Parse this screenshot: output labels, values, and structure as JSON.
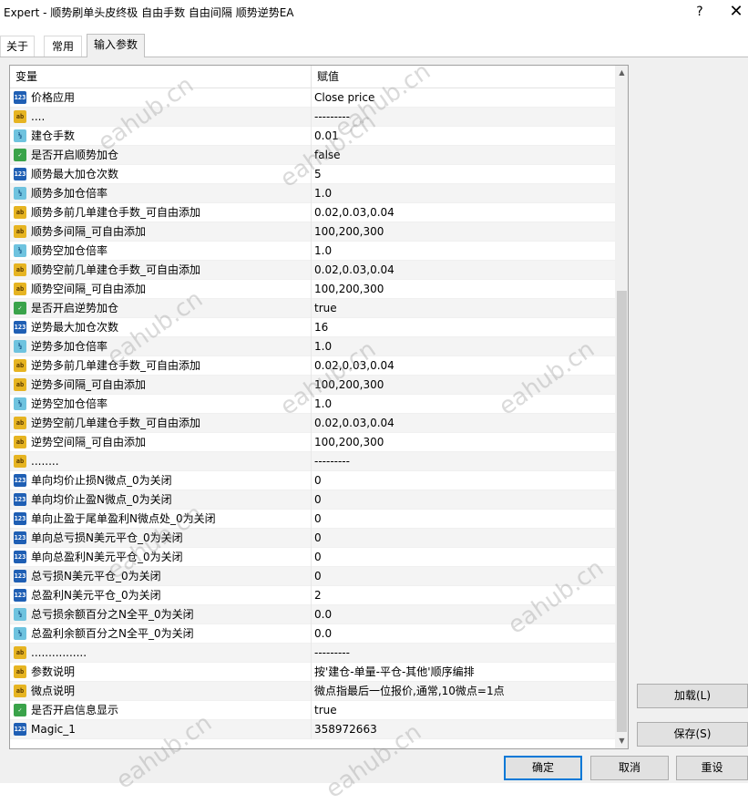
{
  "window": {
    "title": "Expert - 顺势刷单头皮终极 自由手数 自由间隔 顺势逆势EA",
    "help_label": "?",
    "close_label": "✕"
  },
  "tabs": [
    {
      "label": "关于"
    },
    {
      "label": "常用"
    },
    {
      "label": "输入参数"
    }
  ],
  "grid": {
    "col_variable": "变量",
    "col_value": "赋值",
    "rows": [
      {
        "type": "int",
        "icon": "123",
        "name": "价格应用",
        "value": "Close price"
      },
      {
        "type": "str",
        "icon": "ab",
        "name": "....",
        "value": "---------"
      },
      {
        "type": "dbl",
        "icon": "½",
        "name": "建仓手数",
        "value": "0.01"
      },
      {
        "type": "bool",
        "icon": "✓",
        "name": "是否开启顺势加仓",
        "value": "false"
      },
      {
        "type": "int",
        "icon": "123",
        "name": "顺势最大加仓次数",
        "value": "5"
      },
      {
        "type": "dbl",
        "icon": "½",
        "name": "顺势多加仓倍率",
        "value": "1.0"
      },
      {
        "type": "str",
        "icon": "ab",
        "name": "顺势多前几单建仓手数_可自由添加",
        "value": "0.02,0.03,0.04"
      },
      {
        "type": "str",
        "icon": "ab",
        "name": "顺势多间隔_可自由添加",
        "value": "100,200,300"
      },
      {
        "type": "dbl",
        "icon": "½",
        "name": "顺势空加仓倍率",
        "value": "1.0"
      },
      {
        "type": "str",
        "icon": "ab",
        "name": "顺势空前几单建仓手数_可自由添加",
        "value": "0.02,0.03,0.04"
      },
      {
        "type": "str",
        "icon": "ab",
        "name": "顺势空间隔_可自由添加",
        "value": "100,200,300"
      },
      {
        "type": "bool",
        "icon": "✓",
        "name": "是否开启逆势加仓",
        "value": "true"
      },
      {
        "type": "int",
        "icon": "123",
        "name": "逆势最大加仓次数",
        "value": "16"
      },
      {
        "type": "dbl",
        "icon": "½",
        "name": "逆势多加仓倍率",
        "value": "1.0"
      },
      {
        "type": "str",
        "icon": "ab",
        "name": "逆势多前几单建仓手数_可自由添加",
        "value": "0.02,0.03,0.04"
      },
      {
        "type": "str",
        "icon": "ab",
        "name": "逆势多间隔_可自由添加",
        "value": "100,200,300"
      },
      {
        "type": "dbl",
        "icon": "½",
        "name": "逆势空加仓倍率",
        "value": "1.0"
      },
      {
        "type": "str",
        "icon": "ab",
        "name": "逆势空前几单建仓手数_可自由添加",
        "value": "0.02,0.03,0.04"
      },
      {
        "type": "str",
        "icon": "ab",
        "name": "逆势空间隔_可自由添加",
        "value": "100,200,300"
      },
      {
        "type": "str",
        "icon": "ab",
        "name": "........",
        "value": "---------"
      },
      {
        "type": "int",
        "icon": "123",
        "name": "单向均价止损N微点_0为关闭",
        "value": "0"
      },
      {
        "type": "int",
        "icon": "123",
        "name": "单向均价止盈N微点_0为关闭",
        "value": "0"
      },
      {
        "type": "int",
        "icon": "123",
        "name": "单向止盈于尾单盈利N微点处_0为关闭",
        "value": "0"
      },
      {
        "type": "int",
        "icon": "123",
        "name": "单向总亏损N美元平仓_0为关闭",
        "value": "0"
      },
      {
        "type": "int",
        "icon": "123",
        "name": "单向总盈利N美元平仓_0为关闭",
        "value": "0"
      },
      {
        "type": "int",
        "icon": "123",
        "name": "总亏损N美元平仓_0为关闭",
        "value": "0"
      },
      {
        "type": "int",
        "icon": "123",
        "name": "总盈利N美元平仓_0为关闭",
        "value": "2"
      },
      {
        "type": "dbl",
        "icon": "½",
        "name": "总亏损余额百分之N全平_0为关闭",
        "value": "0.0"
      },
      {
        "type": "dbl",
        "icon": "½",
        "name": "总盈利余额百分之N全平_0为关闭",
        "value": "0.0"
      },
      {
        "type": "str",
        "icon": "ab",
        "name": "................",
        "value": "---------"
      },
      {
        "type": "str",
        "icon": "ab",
        "name": "参数说明",
        "value": "按'建仓-单量-平仓-其他'顺序编排"
      },
      {
        "type": "str",
        "icon": "ab",
        "name": "微点说明",
        "value": "微点指最后一位报价,通常,10微点=1点"
      },
      {
        "type": "bool",
        "icon": "✓",
        "name": "是否开启信息显示",
        "value": "true"
      },
      {
        "type": "int",
        "icon": "123",
        "name": "Magic_1",
        "value": "358972663"
      }
    ]
  },
  "scrollbar": {
    "up": "▲",
    "down": "▼"
  },
  "buttons": {
    "load": "加载(L)",
    "save": "保存(S)",
    "ok": "确定",
    "cancel": "取消",
    "reset": "重设"
  },
  "watermark": "eahub.cn"
}
